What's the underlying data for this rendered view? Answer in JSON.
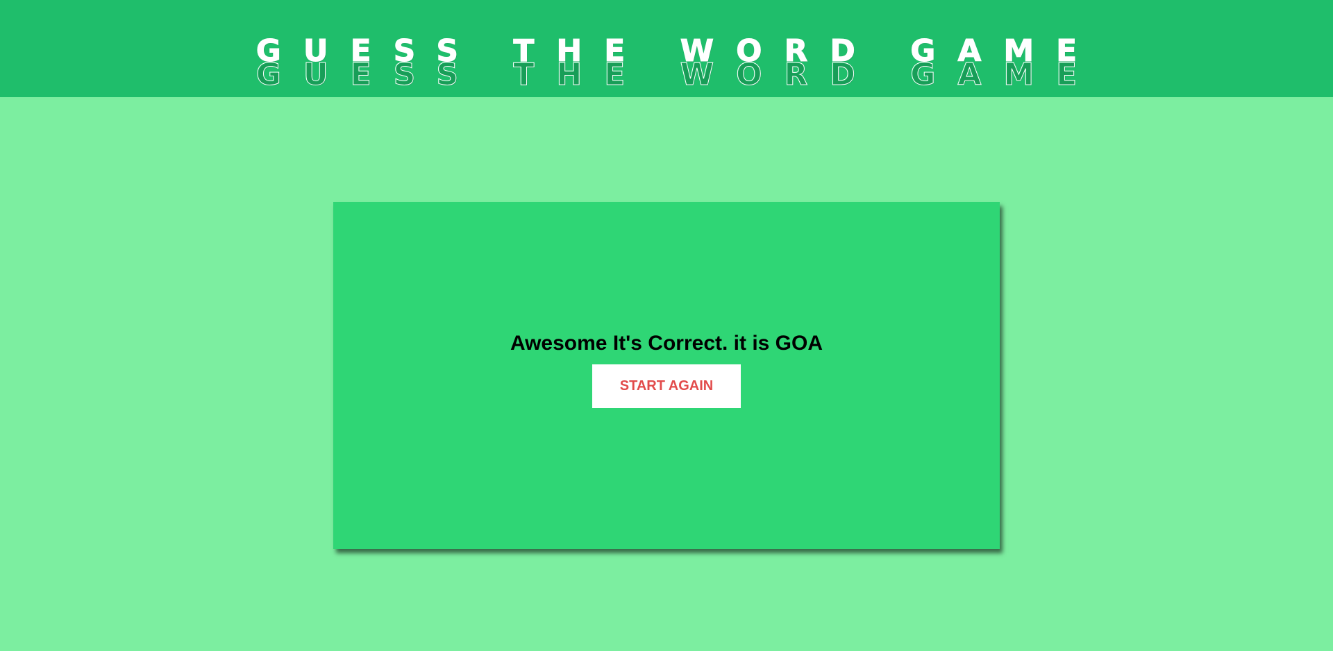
{
  "header": {
    "title": "GUESS THE WORD GAME"
  },
  "result": {
    "message": "Awesome It's Correct. it is GOA",
    "start_again_label": "START AGAIN"
  },
  "colors": {
    "header_bg": "#1fbe6b",
    "page_bg": "#7ceea0",
    "card_bg": "#2fd675",
    "button_text": "#e24b4b"
  }
}
